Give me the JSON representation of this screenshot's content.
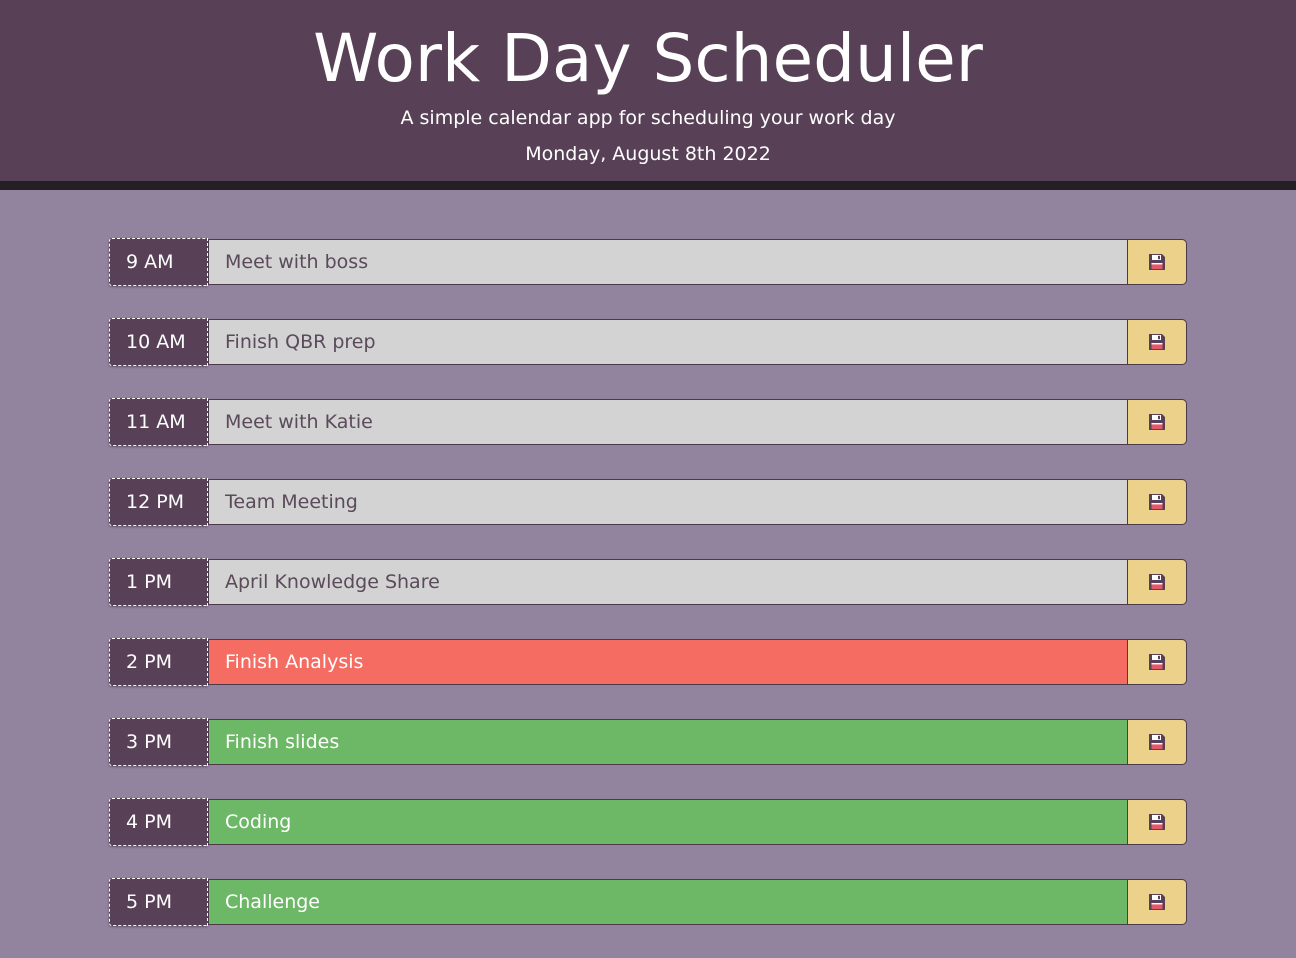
{
  "header": {
    "title": "Work Day Scheduler",
    "subtitle": "A simple calendar app for scheduling your work day",
    "current_date": "Monday, August 8th 2022"
  },
  "colors": {
    "header_bg": "#584157",
    "page_bg": "#92839f",
    "past": "#d3d3d3",
    "present": "#f56d62",
    "future": "#6cb866",
    "save_bg": "#ebd18a"
  },
  "rows": [
    {
      "hour": "9 AM",
      "event": "Meet with boss",
      "status": "past",
      "icon": "floppy-disk-icon"
    },
    {
      "hour": "10 AM",
      "event": "Finish QBR prep",
      "status": "past",
      "icon": "floppy-disk-icon"
    },
    {
      "hour": "11 AM",
      "event": "Meet with Katie",
      "status": "past",
      "icon": "floppy-disk-icon"
    },
    {
      "hour": "12 PM",
      "event": "Team Meeting",
      "status": "past",
      "icon": "floppy-disk-icon"
    },
    {
      "hour": "1 PM",
      "event": "April Knowledge Share",
      "status": "past",
      "icon": "floppy-disk-icon"
    },
    {
      "hour": "2 PM",
      "event": "Finish Analysis",
      "status": "present",
      "icon": "floppy-disk-icon"
    },
    {
      "hour": "3 PM",
      "event": "Finish slides",
      "status": "future",
      "icon": "floppy-disk-icon"
    },
    {
      "hour": "4 PM",
      "event": "Coding",
      "status": "future",
      "icon": "floppy-disk-icon"
    },
    {
      "hour": "5 PM",
      "event": "Challenge",
      "status": "future",
      "icon": "floppy-disk-icon"
    }
  ]
}
